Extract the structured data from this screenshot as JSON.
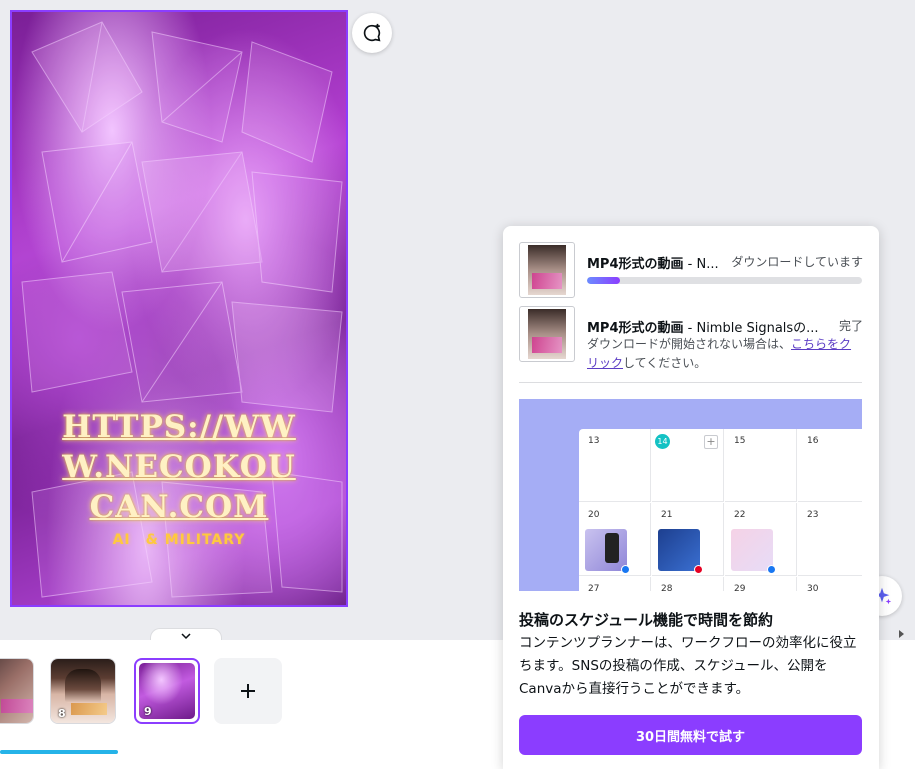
{
  "canvas": {
    "headline": "HTTPS://WWW.NECOKOUCAN.COM",
    "headline_lines": [
      "HTTPS://WW",
      "W.NECOKOU",
      "CAN.COM"
    ],
    "subline": "AI　& MILITARY"
  },
  "filmstrip": {
    "pages": [
      {
        "number": "",
        "selected": false
      },
      {
        "number": "8",
        "selected": false
      },
      {
        "number": "9",
        "selected": true
      }
    ],
    "add_label": "+"
  },
  "download_popup": {
    "items": [
      {
        "title_bold": "MP4形式の動画",
        "title_rest": " - N...",
        "status": "ダウンロードしています",
        "progress": 0.12
      },
      {
        "title_bold": "MP4形式の動画",
        "title_rest": " - Nimble Signalsの...",
        "status": "完了",
        "help_prefix": "ダウンロードが開始されない場合は、",
        "help_link": "こちらをクリック",
        "help_suffix": "してください。"
      }
    ],
    "calendar": {
      "row1": [
        "13",
        "14",
        "15",
        "16"
      ],
      "row2": [
        "20",
        "21",
        "22",
        "23"
      ],
      "row3": [
        "27",
        "28",
        "29",
        "30"
      ],
      "today": "14"
    },
    "promo_title": "投稿のスケジュール機能で時間を節約",
    "promo_body": "コンテンツプランナーは、ワークフローの効率化に役立ちます。SNSの投稿の作成、スケジュール、公開をCanvaから直接行うことができます。",
    "cta_label": "30日間無料で試す"
  },
  "colors": {
    "accent": "#8b3dff",
    "today": "#14c2c4",
    "progress": "#25b3e8"
  },
  "icons": [
    "comment-add-icon",
    "magic-sparkle-icon",
    "chevron-down-icon",
    "chevron-right-icon",
    "plus-icon",
    "facebook-icon",
    "pinterest-icon"
  ]
}
